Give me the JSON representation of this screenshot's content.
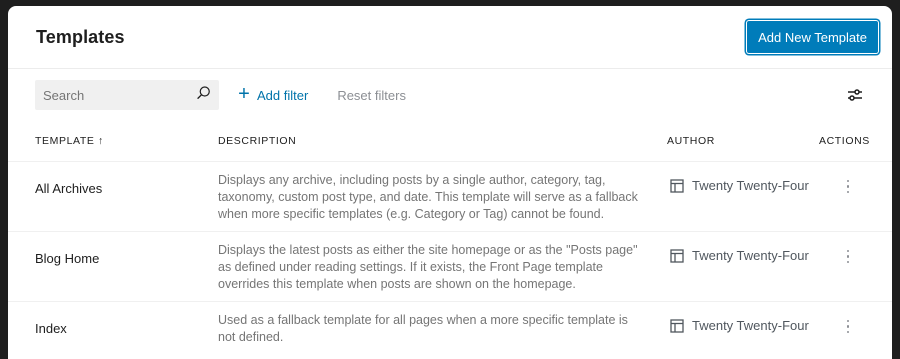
{
  "header": {
    "title": "Templates",
    "add_new_label": "Add New Template"
  },
  "filters": {
    "search_placeholder": "Search",
    "add_filter_label": "Add filter",
    "reset_filters_label": "Reset filters"
  },
  "table": {
    "columns": {
      "template": "TEMPLATE ↑",
      "description": "DESCRIPTION",
      "author": "AUTHOR",
      "actions": "ACTIONS"
    },
    "rows": [
      {
        "name": "All Archives",
        "description": "Displays any archive, including posts by a single author, category, tag, taxonomy, custom post type, and date. This template will serve as a fallback when more specific templates (e.g. Category or Tag) cannot be found.",
        "author": "Twenty Twenty-Four"
      },
      {
        "name": "Blog Home",
        "description": "Displays the latest posts as either the site homepage or as the \"Posts page\" as defined under reading settings. If it exists, the Front Page template overrides this template when posts are shown on the homepage.",
        "author": "Twenty Twenty-Four"
      },
      {
        "name": "Index",
        "description": "Used as a fallback template for all pages when a more specific template is not defined.",
        "author": "Twenty Twenty-Four"
      }
    ]
  },
  "colors": {
    "accent": "#007cba",
    "link": "#0073aa",
    "muted_text": "#757575"
  },
  "icons": {
    "search": "search-icon",
    "add_filter": "plus-icon",
    "view_options": "sliders-icon",
    "author": "layout-icon",
    "actions": "more-vertical-icon"
  }
}
